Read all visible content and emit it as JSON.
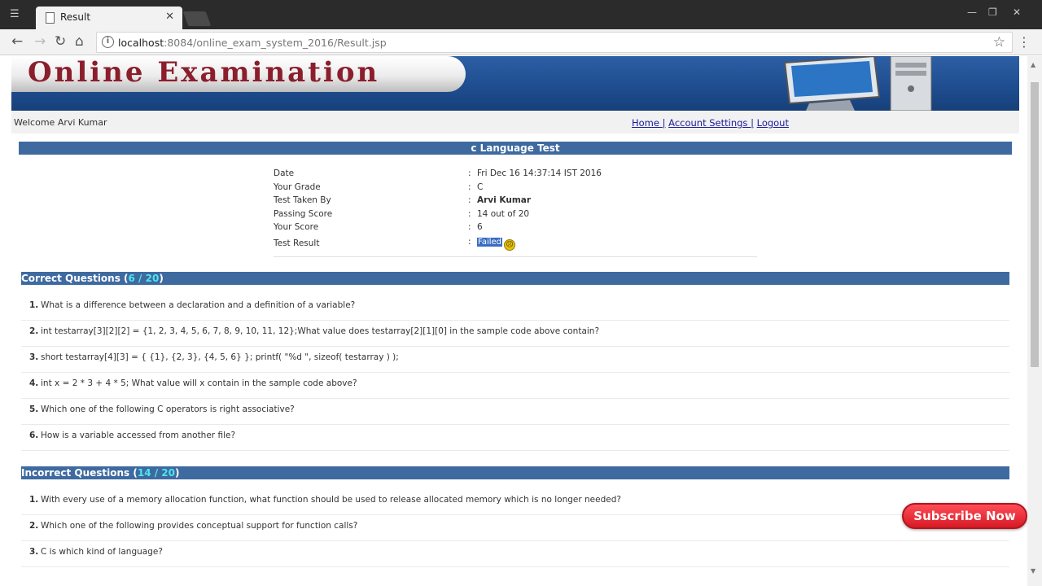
{
  "browser": {
    "tab_title": "Result",
    "tab_close": "✕",
    "url_host": "localhost",
    "url_rest": ":8084/online_exam_system_2016/Result.jsp",
    "window_controls": [
      "—",
      "❐",
      "✕"
    ]
  },
  "header": {
    "title": "Online Examination",
    "welcome": "Welcome Arvi Kumar",
    "links": [
      "Home |",
      "Account Settings |",
      "Logout"
    ]
  },
  "test": {
    "title": "c Language Test",
    "rows": [
      {
        "label": "Date",
        "colon": ":",
        "value": "Fri Dec 16 14:37:14 IST 2016"
      },
      {
        "label": "Your Grade",
        "colon": ":",
        "value": "C"
      },
      {
        "label": "Test Taken By",
        "colon": ":",
        "value": "Arvi Kumar"
      },
      {
        "label": "Passing Score",
        "colon": ":",
        "value": "14 out of 20"
      },
      {
        "label": "Your Score",
        "colon": ":",
        "value": "6"
      },
      {
        "label": "Test Result",
        "colon": ":",
        "value": "Failed"
      }
    ]
  },
  "correct": {
    "label": "Correct Questions (",
    "count": "6 / 20",
    "close": ")",
    "questions": [
      {
        "num": "1.",
        "text": "What is a difference between a declaration and a definition of a variable?"
      },
      {
        "num": "2.",
        "text": "int testarray[3][2][2] = {1, 2, 3, 4, 5, 6, 7, 8, 9, 10, 11, 12};What value does testarray[2][1][0] in the sample code above contain?"
      },
      {
        "num": "3.",
        "text": "short testarray[4][3] = { {1}, {2, 3}, {4, 5, 6} }; printf( \"%d \", sizeof( testarray ) );"
      },
      {
        "num": "4.",
        "text": "int x = 2 * 3 + 4 * 5; What value will x contain in the sample code above?"
      },
      {
        "num": "5.",
        "text": "Which one of the following C operators is right associative?"
      },
      {
        "num": "6.",
        "text": "How is a variable accessed from another file?"
      }
    ]
  },
  "incorrect": {
    "label": "Incorrect Questions (",
    "count": "14 / 20",
    "close": ")",
    "questions": [
      {
        "num": "1.",
        "text": "With every use of a memory allocation function, what function should be used to release allocated memory which is no longer needed?"
      },
      {
        "num": "2.",
        "text": "Which one of the following provides conceptual support for function calls?"
      },
      {
        "num": "3.",
        "text": "C is which kind of language?"
      }
    ]
  },
  "overlay": {
    "subscribe": "Subscribe Now"
  },
  "colors": {
    "banner": "#1e4c8e",
    "section_header": "#3e6aa0",
    "count_highlight": "#4de5f0",
    "subscribe": "#d71a25"
  }
}
